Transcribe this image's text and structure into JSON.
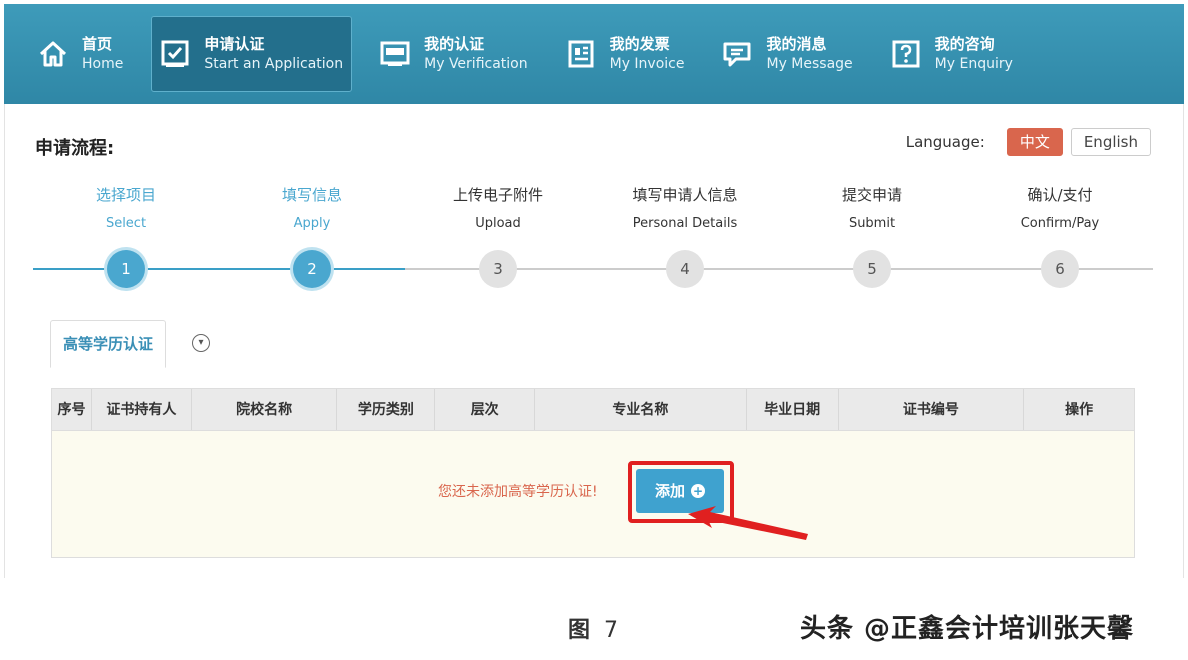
{
  "nav": [
    {
      "zh": "首页",
      "en": "Home",
      "icon": "home-icon",
      "active": false
    },
    {
      "zh": "申请认证",
      "en": "Start an Application",
      "icon": "checkbox-icon",
      "active": true
    },
    {
      "zh": "我的认证",
      "en": "My Verification",
      "icon": "verification-icon",
      "active": false
    },
    {
      "zh": "我的发票",
      "en": "My Invoice",
      "icon": "invoice-icon",
      "active": false
    },
    {
      "zh": "我的消息",
      "en": "My Message",
      "icon": "message-icon",
      "active": false
    },
    {
      "zh": "我的咨询",
      "en": "My Enquiry",
      "icon": "enquiry-icon",
      "active": false
    }
  ],
  "flow_title": "申请流程:",
  "language": {
    "label": "Language:",
    "zh": "中文",
    "en": "English"
  },
  "steps": [
    {
      "zh": "选择项目",
      "en": "Select",
      "num": "1",
      "done": true
    },
    {
      "zh": "填写信息",
      "en": "Apply",
      "num": "2",
      "done": true
    },
    {
      "zh": "上传电子附件",
      "en": "Upload",
      "num": "3",
      "done": false
    },
    {
      "zh": "填写申请人信息",
      "en": "Personal Details",
      "num": "4",
      "done": false
    },
    {
      "zh": "提交申请",
      "en": "Submit",
      "num": "5",
      "done": false
    },
    {
      "zh": "确认/支付",
      "en": "Confirm/Pay",
      "num": "6",
      "done": false
    }
  ],
  "tab": {
    "label": "高等学历认证"
  },
  "table": {
    "headers": [
      "序号",
      "证书持有人",
      "院校名称",
      "学历类别",
      "层次",
      "专业名称",
      "毕业日期",
      "证书编号",
      "操作"
    ],
    "empty_text": "您还未添加高等学历认证!",
    "add_label": "添加"
  },
  "caption": {
    "label": "图",
    "num": "7"
  },
  "watermark": "头条 @正鑫会计培训张天馨",
  "colors": {
    "nav": "#3e9bba",
    "accent": "#4aa7cf",
    "lang_active": "#d9664d",
    "highlight": "#e02020"
  }
}
